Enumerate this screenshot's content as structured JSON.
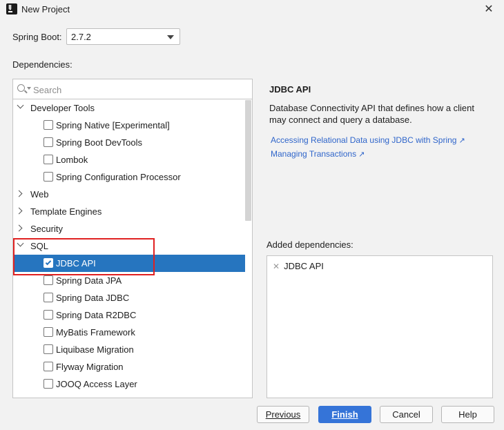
{
  "window": {
    "title": "New Project"
  },
  "spring_boot": {
    "label": "Spring Boot:",
    "version": "2.7.2"
  },
  "dependencies": {
    "label": "Dependencies:",
    "search_placeholder": "Search",
    "tree": [
      {
        "kind": "group",
        "label": "Developer Tools",
        "expanded": true
      },
      {
        "kind": "item",
        "label": "Spring Native [Experimental]",
        "checked": false
      },
      {
        "kind": "item",
        "label": "Spring Boot DevTools",
        "checked": false
      },
      {
        "kind": "item",
        "label": "Lombok",
        "checked": false
      },
      {
        "kind": "item",
        "label": "Spring Configuration Processor",
        "checked": false
      },
      {
        "kind": "group",
        "label": "Web",
        "expanded": false
      },
      {
        "kind": "group",
        "label": "Template Engines",
        "expanded": false
      },
      {
        "kind": "group",
        "label": "Security",
        "expanded": false
      },
      {
        "kind": "group",
        "label": "SQL",
        "expanded": true
      },
      {
        "kind": "item",
        "label": "JDBC API",
        "checked": true,
        "selected": true
      },
      {
        "kind": "item",
        "label": "Spring Data JPA",
        "checked": false
      },
      {
        "kind": "item",
        "label": "Spring Data JDBC",
        "checked": false
      },
      {
        "kind": "item",
        "label": "Spring Data R2DBC",
        "checked": false
      },
      {
        "kind": "item",
        "label": "MyBatis Framework",
        "checked": false
      },
      {
        "kind": "item",
        "label": "Liquibase Migration",
        "checked": false
      },
      {
        "kind": "item",
        "label": "Flyway Migration",
        "checked": false
      },
      {
        "kind": "item",
        "label": "JOOQ Access Layer",
        "checked": false
      }
    ]
  },
  "details": {
    "title": "JDBC API",
    "description": "Database Connectivity API that defines how a client may connect and query a database.",
    "links": [
      "Accessing Relational Data using JDBC with Spring",
      "Managing Transactions"
    ]
  },
  "added": {
    "label": "Added dependencies:",
    "items": [
      "JDBC API"
    ]
  },
  "buttons": {
    "previous": "Previous",
    "finish": "Finish",
    "cancel": "Cancel",
    "help": "Help"
  },
  "colors": {
    "selection": "#2675bf",
    "primary_button": "#3574d8",
    "link": "#2f65ca",
    "highlight_box": "#e02020"
  }
}
